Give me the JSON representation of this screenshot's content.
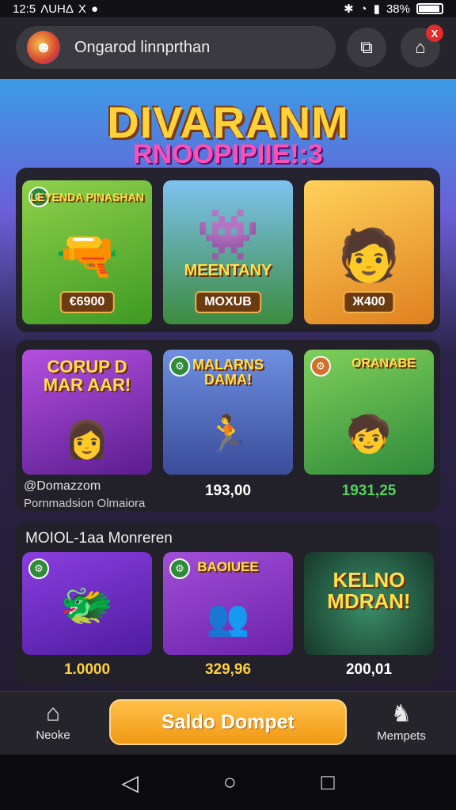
{
  "status": {
    "time": "12:5",
    "left_text": "ΛUHΔ",
    "x": "X",
    "battery": "38%"
  },
  "header": {
    "search_text": "Ongarod linnprthan",
    "notif_count": "X"
  },
  "hero": {
    "title": "DIVARANM",
    "subtitle": "RNOOPIPIIE!:3"
  },
  "row1": [
    {
      "caption": "LEYENDA PINASHAN",
      "price": "€6900",
      "bg": "#4caf31"
    },
    {
      "caption": "MEENTANY",
      "price": "MOXUB",
      "bg": "#6fa5d8"
    },
    {
      "caption": "",
      "price": "Ж400",
      "bg": "#e79a28"
    }
  ],
  "row2": [
    {
      "caption": "CORUP D MAR AAR!",
      "bg": "#8a3fc1"
    },
    {
      "caption": "MALARNS DAMA!",
      "bg": "#5a79c9"
    },
    {
      "caption": "ORANABE",
      "bg": "#58b646"
    }
  ],
  "row2_values": {
    "left_line1": "@Domazzom",
    "left_line2": "Pornmadsion Olmaiora",
    "mid": "193,00",
    "right": "1931,25"
  },
  "section3": {
    "title": "MOIOL-1aa Monreren",
    "cards": [
      {
        "caption": "",
        "bg": "#7a2bd1"
      },
      {
        "caption": "BAOIUEE",
        "bg": "#8c34c6"
      },
      {
        "caption": "KELNO MDRAN!",
        "bg": "#2c6b4e"
      }
    ],
    "values": [
      "1.0000",
      "329,96",
      "200,01"
    ]
  },
  "bottom_nav": {
    "home_label": "Neoke",
    "cta_label": "Saldo Dompet",
    "wallet_label": "Mempets"
  }
}
